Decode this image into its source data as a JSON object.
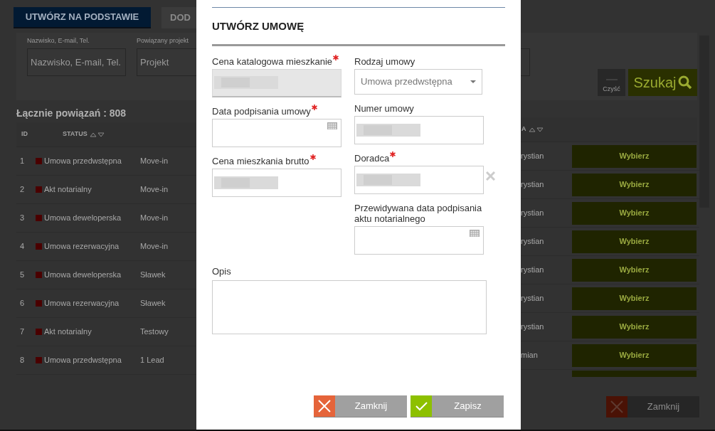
{
  "toolbar": {
    "buttons": [
      {
        "label": "UTWÓRZ NA PODSTAWIE",
        "kind": "primary"
      },
      {
        "label": "DOD",
        "kind": "secondary"
      }
    ]
  },
  "filters": {
    "fields": [
      {
        "label": "Nazwisko, E-mail, Tel.",
        "placeholder": "Nazwisko, E-mail, Tel."
      },
      {
        "label": "Powiązany projekt",
        "placeholder": "Projekt"
      }
    ],
    "clear_button": "Czyść",
    "search_button": "Szukaj"
  },
  "total": "Łącznie powiązań : 808",
  "table": {
    "columns": [
      "ID",
      "STATUS",
      "A"
    ],
    "rows": [
      {
        "id": "1",
        "status": "Umowa przedwstępna",
        "project": "Move-in",
        "advisor": "rystian",
        "action": "Wybierz"
      },
      {
        "id": "2",
        "status": "Akt notarialny",
        "project": "Move-in",
        "advisor": "rystian",
        "action": "Wybierz"
      },
      {
        "id": "3",
        "status": "Umowa deweloperska",
        "project": "Move-in",
        "advisor": "rystian",
        "action": "Wybierz"
      },
      {
        "id": "4",
        "status": "Umowa rezerwacyjna",
        "project": "Move-in",
        "advisor": "rystian",
        "action": "Wybierz"
      },
      {
        "id": "5",
        "status": "Umowa deweloperska",
        "project": "Sławek",
        "advisor": "rystian",
        "action": "Wybierz"
      },
      {
        "id": "6",
        "status": "Umowa rezerwacyjna",
        "project": "Sławek",
        "advisor": "rystian",
        "action": "Wybierz"
      },
      {
        "id": "7",
        "status": "Akt notarialny",
        "project": "Testowy",
        "advisor": "rystian",
        "action": "Wybierz"
      },
      {
        "id": "8",
        "status": "Umowa przedwstępna",
        "project": "1 Lead",
        "advisor": "mian",
        "action": "Wybierz"
      }
    ]
  },
  "close_button": "Zamknij",
  "dialog": {
    "title": "UTWÓRZ UMOWĘ",
    "left_column": [
      {
        "label": "Cena katalogowa mieszkanie",
        "required": true,
        "kind": "text",
        "disabled": true,
        "blurred": true
      },
      {
        "label": "Data podpisania umowy",
        "required": true,
        "kind": "date",
        "disabled": false,
        "blurred": false
      },
      {
        "label": "Cena mieszkania brutto",
        "required": true,
        "kind": "text",
        "disabled": false,
        "blurred": true
      }
    ],
    "right_column": [
      {
        "label": "Rodzaj umowy",
        "required": false,
        "kind": "select",
        "value": "Umowa przedwstępna"
      },
      {
        "label": "Numer umowy",
        "required": false,
        "kind": "text",
        "disabled": false,
        "blurred": true
      },
      {
        "label": "Doradca",
        "required": true,
        "kind": "text",
        "disabled": false,
        "blurred": true,
        "clearable": true
      },
      {
        "label": "Przewidywana data podpisania aktu notarialnego",
        "required": false,
        "kind": "date",
        "disabled": false,
        "blurred": false
      }
    ],
    "description": {
      "label": "Opis"
    },
    "buttons": [
      {
        "label": "Zamknij",
        "kind": "cancel"
      },
      {
        "label": "Zapisz",
        "kind": "save"
      }
    ]
  }
}
